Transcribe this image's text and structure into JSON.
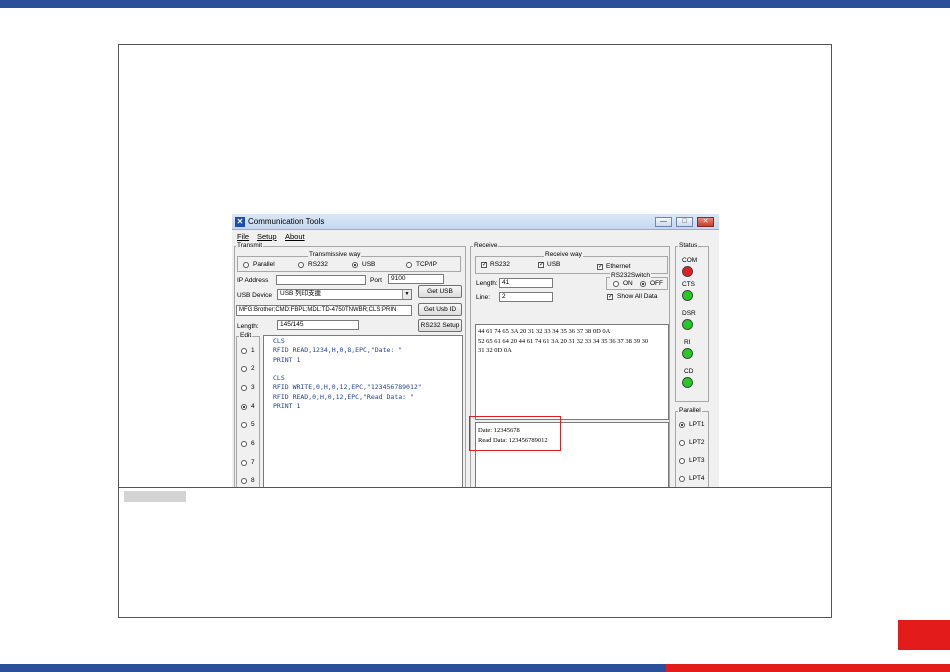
{
  "window": {
    "title": "Communication Tools",
    "controls": {
      "minimize": "—",
      "maximize": "□",
      "close": "✕"
    }
  },
  "menu": [
    "File",
    "Setup",
    "About"
  ],
  "transmit": {
    "group_label": "Transmit",
    "way_label": "Transmissive way",
    "ways": [
      {
        "label": "Parallel",
        "selected": false
      },
      {
        "label": "RS232",
        "selected": false
      },
      {
        "label": "USB",
        "selected": true
      },
      {
        "label": "TCP/IP",
        "selected": false
      }
    ],
    "ip_label": "IP Address",
    "ip_value": "",
    "port_label": "Port",
    "port_value": "9100",
    "usb_device_label": "USB Device",
    "usb_device_value": "USB 列印支援",
    "get_usb_label": "Get USB",
    "usb_id_value": "MFG:Brother;CMD:FBPL;MDL:TD-4750TNWBR;CLS:PRIN",
    "get_usb_id_label": "Get Usb ID",
    "length_label": "Length:",
    "length_value": "145/145",
    "rs232_setup_label": "RS232 Setup",
    "edit_label": "Edit",
    "edit_items": [
      {
        "label": "1",
        "selected": false
      },
      {
        "label": "2",
        "selected": false
      },
      {
        "label": "3",
        "selected": false
      },
      {
        "label": "4",
        "selected": true
      },
      {
        "label": "5",
        "selected": false
      },
      {
        "label": "6",
        "selected": false
      },
      {
        "label": "7",
        "selected": false
      },
      {
        "label": "8",
        "selected": false
      }
    ],
    "code": "CLS\nRFID READ,1234,H,0,8,EPC,\"Date: \"\nPRINT 1\n\nCLS\nRFID WRITE,0,H,0,12,EPC,\"123456789012\"\nRFID READ,0,H,0,12,EPC,\"Read Data: \"\nPRINT 1"
  },
  "receive": {
    "group_label": "Receive",
    "way_label": "Receive way",
    "rs232_label": "RS232",
    "usb_label": "USB",
    "ethernet_label": "Ethernet",
    "length_label": "Length:",
    "length_value": "41",
    "line_label": "Line:",
    "line_value": "2",
    "rs232switch_label": "RS232Switch",
    "on_label": "ON",
    "off_label": "OFF",
    "show_all_label": "Show All Data",
    "hex_lines": [
      "44 61 74 65 3A 20 31 32 33 34 35 36 37 38 0D 0A",
      "52 65 61 64 20 44 61 74 61 3A 20 31 32 33 34 35 36 37 38 39 30",
      "31 32 0D 0A"
    ],
    "text_lines": [
      "Date: 12345678",
      "Read Data: 123456789012"
    ]
  },
  "status": {
    "group_label": "Status",
    "leds": [
      {
        "label": "COM",
        "color": "#e02020"
      },
      {
        "label": "CTS",
        "color": "#22cc22"
      },
      {
        "label": "DSR",
        "color": "#22cc22"
      },
      {
        "label": "RI",
        "color": "#22cc22"
      },
      {
        "label": "CD",
        "color": "#22cc22"
      }
    ]
  },
  "parallel": {
    "group_label": "Parallel",
    "ports": [
      {
        "label": "LPT1",
        "selected": true
      },
      {
        "label": "LPT2",
        "selected": false
      },
      {
        "label": "LPT3",
        "selected": false
      },
      {
        "label": "LPT4",
        "selected": false
      }
    ]
  },
  "theme": {
    "accent_blue": "#2c4f9a",
    "accent_red": "#e31b1b"
  }
}
